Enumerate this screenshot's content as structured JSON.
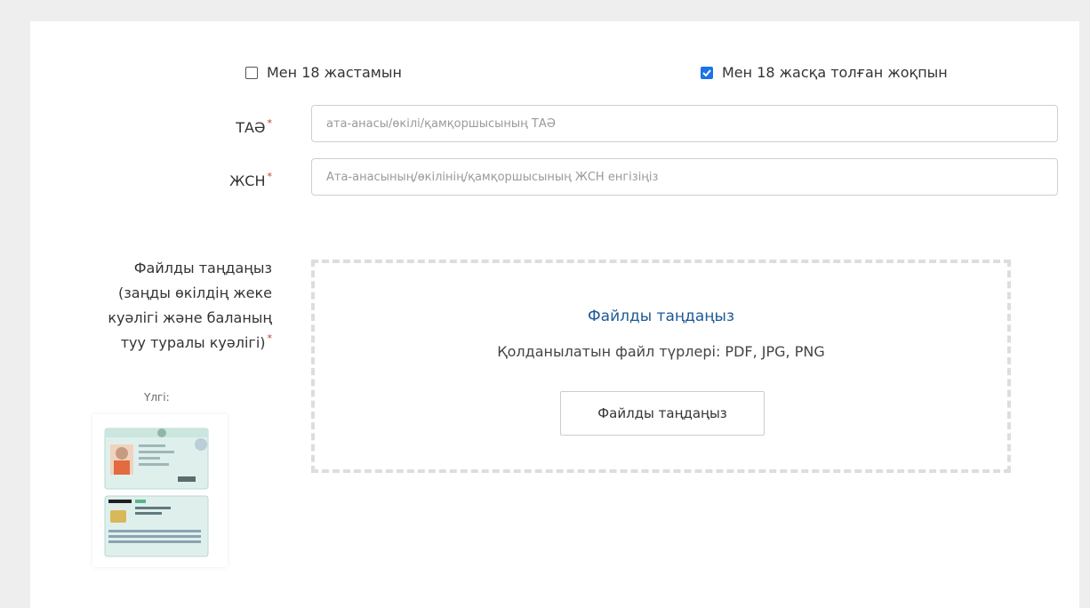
{
  "age_options": {
    "adult": {
      "label": "Мен 18 жастамын",
      "checked": false
    },
    "minor": {
      "label": "Мен 18 жасқа толған жоқпын",
      "checked": true
    }
  },
  "fields": {
    "fullname": {
      "label": "ТАӘ",
      "required_mark": "*",
      "placeholder": "ата-анасы/өкілі/қамқоршысының ТАӘ",
      "value": ""
    },
    "iin": {
      "label": "ЖСН",
      "required_mark": "*",
      "placeholder": "Ата-анасының/өкілінің/қамқоршысының ЖСН енгізіңіз",
      "value": ""
    }
  },
  "file_section": {
    "label_lines": [
      "Файлды таңдаңыз",
      "(заңды өкілдің жеке",
      "куәлігі және баланың",
      "туу туралы куәлігі)"
    ],
    "required_mark": "*",
    "sample_label": "Үлгі:",
    "dropzone": {
      "title": "Файлды таңдаңыз",
      "types": "Қолданылатын файл түрлері: PDF, JPG, PNG",
      "button": "Файлды таңдаңыз"
    }
  },
  "colors": {
    "checkbox_checked": "#1a73e8",
    "required_star": "#c0392b",
    "dropzone_title": "#1e5a96",
    "page_background": "#eeeeee"
  }
}
